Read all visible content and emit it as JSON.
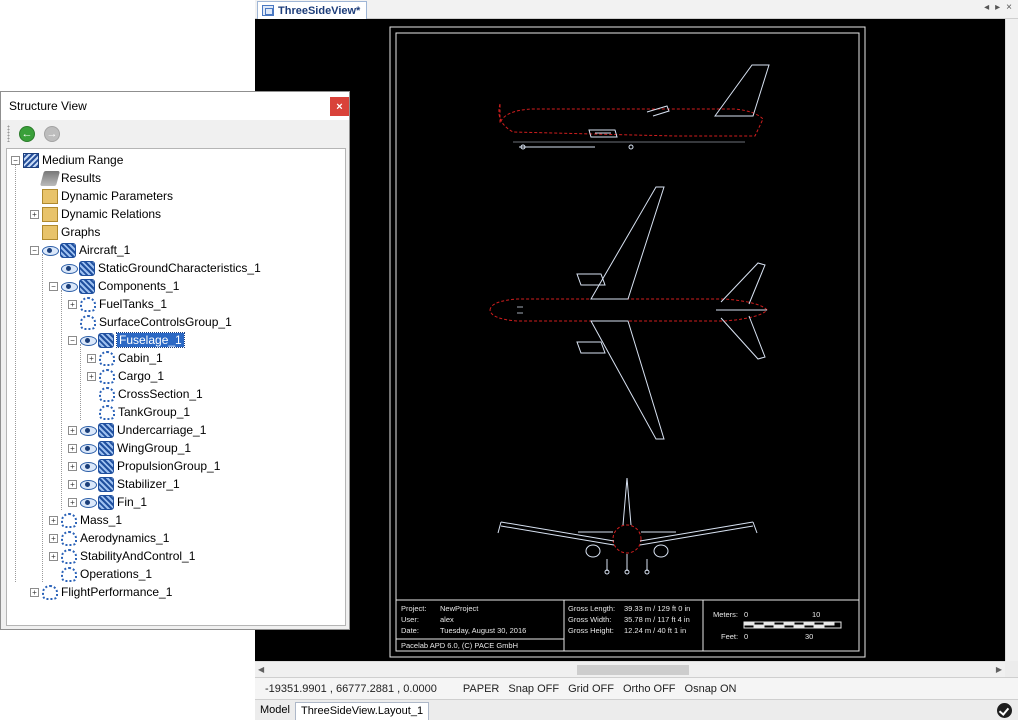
{
  "document": {
    "tab_title": "ThreeSideView*",
    "window_controls": [
      "◂",
      "▸",
      "×"
    ],
    "title_block": {
      "project_label": "Project:",
      "project": "NewProject",
      "user_label": "User:",
      "user": "alex",
      "date_label": "Date:",
      "date": "Tuesday, August 30, 2016",
      "footer": "Pacelab APD 6.0, (C) PACE GmbH",
      "gross_length_label": "Gross Length:",
      "gross_length": "39.33 m / 129 ft 0 in",
      "gross_width_label": "Gross Width:",
      "gross_width": "35.78 m / 117 ft 4 in",
      "gross_height_label": "Gross Height:",
      "gross_height": "12.24 m / 40 ft 1 in",
      "scale_meters_label": "Meters:",
      "scale_meters_min": "0",
      "scale_meters_max": "10",
      "scale_feet_label": "Feet:",
      "scale_feet_min": "0",
      "scale_feet_max": "30"
    }
  },
  "status_bar": {
    "coords": "-19351.9901 , 66777.2881 , 0.0000",
    "paper": "PAPER",
    "snap": "Snap OFF",
    "grid": "Grid OFF",
    "ortho": "Ortho OFF",
    "osnap": "Osnap ON"
  },
  "layout_tabs": [
    "Model",
    "ThreeSideView.Layout_1"
  ],
  "structure_view": {
    "title": "Structure View",
    "close_glyph": "×",
    "back_glyph": "←",
    "forward_glyph": "→",
    "tree": [
      {
        "label": "Medium Range",
        "level": 0,
        "exp": "−",
        "icon": "root"
      },
      {
        "label": "Results",
        "level": 1,
        "exp": "",
        "icon": "results"
      },
      {
        "label": "Dynamic Parameters",
        "level": 1,
        "exp": "",
        "icon": "folder"
      },
      {
        "label": "Dynamic Relations",
        "level": 1,
        "exp": "+",
        "icon": "folder"
      },
      {
        "label": "Graphs",
        "level": 1,
        "exp": "",
        "icon": "folder"
      },
      {
        "label": "Aircraft_1",
        "level": 1,
        "exp": "−",
        "icon": "component",
        "eye": true
      },
      {
        "label": "StaticGroundCharacteristics_1",
        "level": 2,
        "exp": "",
        "icon": "component",
        "eye": true
      },
      {
        "label": "Components_1",
        "level": 2,
        "exp": "−",
        "icon": "component",
        "eye": true
      },
      {
        "label": "FuelTanks_1",
        "level": 3,
        "exp": "+",
        "icon": "part"
      },
      {
        "label": "SurfaceControlsGroup_1",
        "level": 3,
        "exp": "",
        "icon": "part"
      },
      {
        "label": "Fuselage_1",
        "level": 3,
        "exp": "−",
        "icon": "component",
        "eye": true,
        "selected": true
      },
      {
        "label": "Cabin_1",
        "level": 4,
        "exp": "+",
        "icon": "part"
      },
      {
        "label": "Cargo_1",
        "level": 4,
        "exp": "+",
        "icon": "part"
      },
      {
        "label": "CrossSection_1",
        "level": 4,
        "exp": "",
        "icon": "part"
      },
      {
        "label": "TankGroup_1",
        "level": 4,
        "exp": "",
        "icon": "part"
      },
      {
        "label": "Undercarriage_1",
        "level": 3,
        "exp": "+",
        "icon": "component",
        "eye": true
      },
      {
        "label": "WingGroup_1",
        "level": 3,
        "exp": "+",
        "icon": "component",
        "eye": true
      },
      {
        "label": "PropulsionGroup_1",
        "level": 3,
        "exp": "+",
        "icon": "component",
        "eye": true
      },
      {
        "label": "Stabilizer_1",
        "level": 3,
        "exp": "+",
        "icon": "component",
        "eye": true
      },
      {
        "label": "Fin_1",
        "level": 3,
        "exp": "+",
        "icon": "component",
        "eye": true
      },
      {
        "label": "Mass_1",
        "level": 2,
        "exp": "+",
        "icon": "part"
      },
      {
        "label": "Aerodynamics_1",
        "level": 2,
        "exp": "+",
        "icon": "part"
      },
      {
        "label": "StabilityAndControl_1",
        "level": 2,
        "exp": "+",
        "icon": "part"
      },
      {
        "label": "Operations_1",
        "level": 2,
        "exp": "",
        "icon": "part"
      },
      {
        "label": "FlightPerformance_1",
        "level": 1,
        "exp": "+",
        "icon": "part"
      }
    ]
  },
  "colors": {
    "viewport_bg": "#000000",
    "aircraft_line": "#d8e2f2",
    "fuselage_highlight": "#d01e1e",
    "selection": "#2b68c4"
  }
}
